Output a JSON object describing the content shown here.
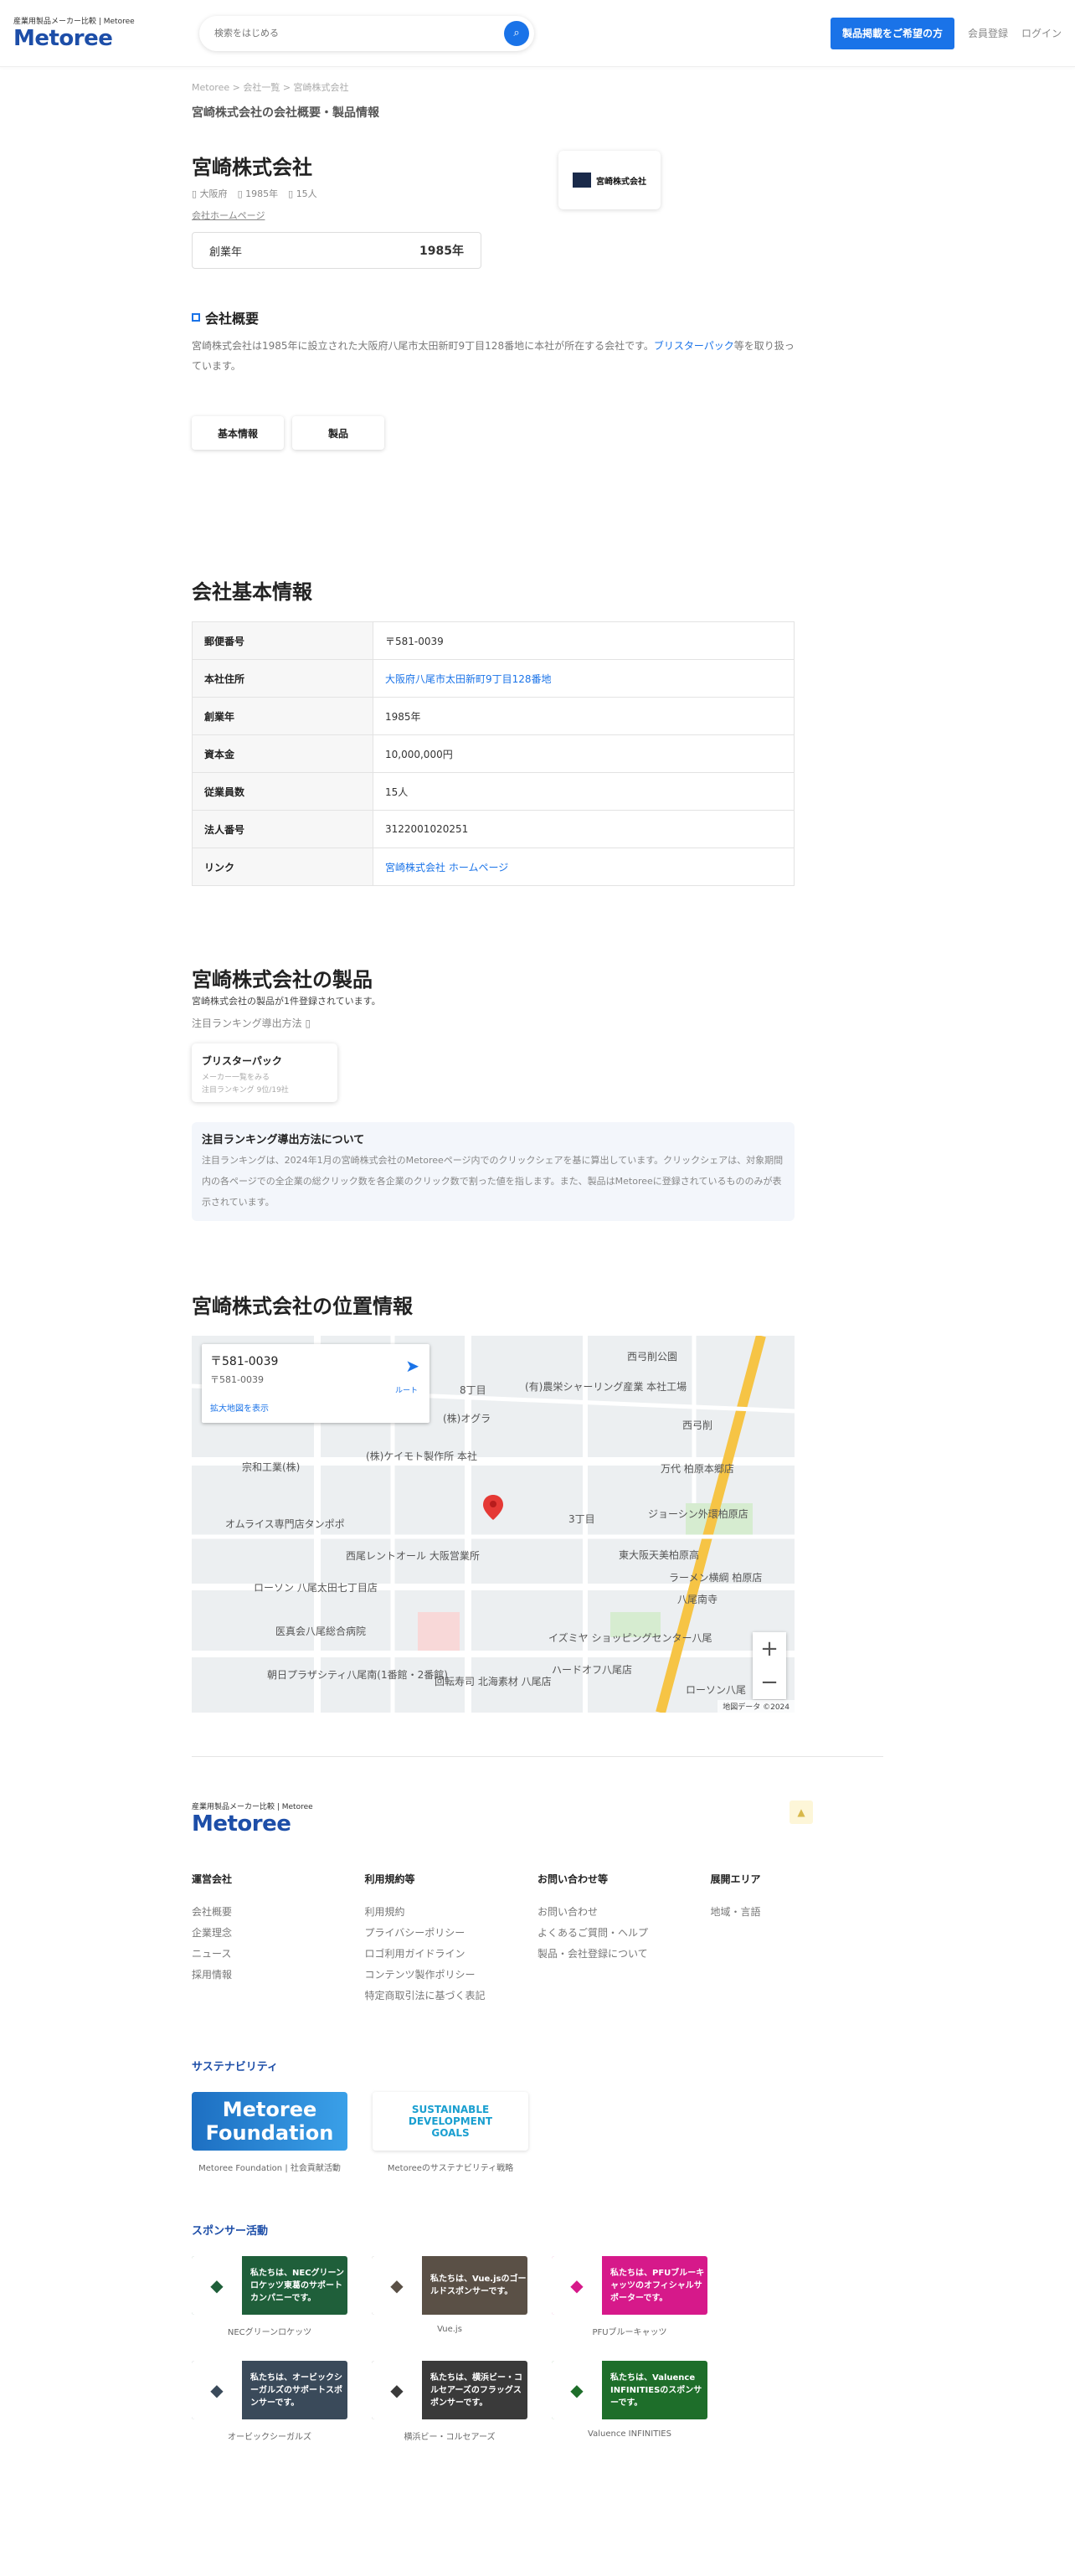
{
  "header": {
    "tagline": "産業用製品メーカー比較 | Metoree",
    "logo": "Metoree",
    "search_placeholder": "検索をはじめる",
    "cta": "製品掲載をご希望の方",
    "register": "会員登録",
    "login": "ログイン"
  },
  "breadcrumb": "Metoree > 会社一覧 > 宮崎株式会社",
  "page_subtitle": "宮崎株式会社の会社概要・製品情報",
  "company": {
    "name": "宮崎株式会社",
    "prefecture": "大阪府",
    "founded": "1985年",
    "employees": "15人",
    "homepage_link": "会社ホームページ",
    "logo_text": "宮崎株式会社",
    "founded_label": "創業年",
    "founded_value": "1985年"
  },
  "overview": {
    "title": "会社概要",
    "text_before": "宮崎株式会社は1985年に設立された大阪府八尾市太田新町9丁目128番地に本社が所在する会社です。",
    "text_link": "ブリスターパック",
    "text_after": "等を取り扱っています。"
  },
  "tabs": [
    "基本情報",
    "製品"
  ],
  "basic_info": {
    "title": "会社基本情報",
    "rows": [
      {
        "k": "郵便番号",
        "v": "〒581-0039",
        "link": false
      },
      {
        "k": "本社住所",
        "v": "大阪府八尾市太田新町9丁目128番地",
        "link": true
      },
      {
        "k": "創業年",
        "v": "1985年",
        "link": false
      },
      {
        "k": "資本金",
        "v": "10,000,000円",
        "link": false
      },
      {
        "k": "従業員数",
        "v": "15人",
        "link": false
      },
      {
        "k": "法人番号",
        "v": "3122001020251",
        "link": false
      },
      {
        "k": "リンク",
        "v": "宮崎株式会社 ホームページ",
        "link": true
      }
    ]
  },
  "products": {
    "title": "宮崎株式会社の製品",
    "sub": "宮崎株式会社の製品が1件登録されています。",
    "ranking_link": "注目ランキング導出方法",
    "card_name": "ブリスターパック",
    "card_sub1": "メーカー一覧をみる",
    "card_sub2": "注目ランキング 9位/19社",
    "note_title": "注目ランキング導出方法について",
    "note_body": "注目ランキングは、2024年1月の宮崎株式会社のMetoreeページ内でのクリックシェアを基に算出しています。クリックシェアは、対象期間内の各ページでの全企業の総クリック数を各企業のクリック数で割った値を指します。また、製品はMetoreeに登録されているもののみが表示されています。"
  },
  "location": {
    "title": "宮崎株式会社の位置情報",
    "map_zip": "〒581-0039",
    "map_addr": "〒581-0039",
    "map_link": "拡大地図を表示",
    "map_dir": "ルート",
    "map_copyright": "地図データ ©2024",
    "labels": [
      "西弓削公園",
      "(有)農栄シャーリング産業 本社工場",
      "(株)オグラ",
      "西弓削",
      "(株)ケイモト製作所 本社",
      "宗和工業(株)",
      "万代 柏原本郷店",
      "オムライス専門店タンポポ",
      "ジョーシン外環柏原店",
      "西尾レントオール 大阪営業所",
      "東大阪天美柏原高",
      "ローソン 八尾太田七丁目店",
      "ラーメン横綱 柏原店",
      "医真会八尾総合病院",
      "イズミヤ ショッピングセンター八尾",
      "朝日プラザシティ八尾南(1番館・2番館)",
      "ハードオフ八尾店",
      "回転寿司 北海素材 八尾店",
      "ローソン八尾",
      "3丁目",
      "8丁目",
      "八尾南寺"
    ]
  },
  "footer": {
    "tagline": "産業用製品メーカー比較 | Metoree",
    "logo": "Metoree",
    "cols": [
      {
        "title": "運営会社",
        "items": [
          "会社概要",
          "企業理念",
          "ニュース",
          "採用情報"
        ]
      },
      {
        "title": "利用規約等",
        "items": [
          "利用規約",
          "プライバシーポリシー",
          "ロゴ利用ガイドライン",
          "コンテンツ製作ポリシー",
          "特定商取引法に基づく表記"
        ]
      },
      {
        "title": "お問い合わせ等",
        "items": [
          "お問い合わせ",
          "よくあるご質問・ヘルプ",
          "製品・会社登録について"
        ]
      },
      {
        "title": "展開エリア",
        "items": [
          "地域・言語"
        ]
      }
    ],
    "sustainability_title": "サステナビリティ",
    "sustainability": [
      {
        "img": "Metoree Foundation",
        "cap": "Metoree Foundation | 社会貢献活動"
      },
      {
        "img": "SUSTAINABLE DEVELOPMENT GOALS",
        "cap": "Metoreeのサステナビリティ戦略"
      }
    ],
    "sponsor_title": "スポンサー活動",
    "sponsors": [
      {
        "txt": "私たちは、NECグリーンロケッツ東葛のサポートカンパニーです。",
        "cap": "NECグリーンロケッツ",
        "color": "#1f5f3a"
      },
      {
        "txt": "私たちは、Vue.jsのゴールドスポンサーです。",
        "cap": "Vue.js",
        "color": "#5a5046"
      },
      {
        "txt": "私たちは、PFUブルーキャッツのオフィシャルサポーターです。",
        "cap": "PFUブルーキャッツ",
        "color": "#d6198a"
      },
      {
        "txt": "私たちは、オービックシーガルズのサポートスポンサーです。",
        "cap": "オービックシーガルズ",
        "color": "#3a4a5a"
      },
      {
        "txt": "私たちは、横浜ビー・コルセアーズのフラッグスポンサーです。",
        "cap": "横浜ビー・コルセアーズ",
        "color": "#3a3a3a"
      },
      {
        "txt": "私たちは、Valuence INFINITIESのスポンサーです。",
        "cap": "Valuence INFINITIES",
        "color": "#1e6e2a"
      }
    ]
  }
}
